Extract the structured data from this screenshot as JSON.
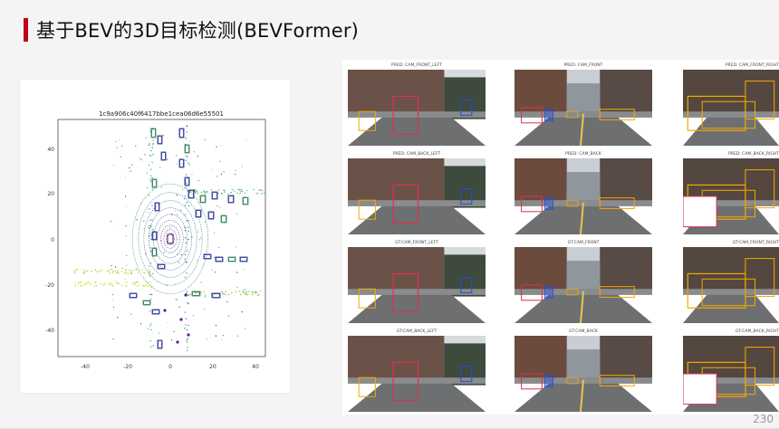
{
  "slide": {
    "title": "基于BEV的3D目标检测(BEVFormer)",
    "page_number": "230",
    "accent_color": "#c0001a"
  },
  "bev_plot": {
    "title": "1c9a906c40f6417bbe1cea06d6e55501",
    "x_ticks": [
      "-40",
      "-20",
      "0",
      "20",
      "40"
    ],
    "y_ticks": [
      "40",
      "20",
      "0",
      "-20",
      "-40"
    ]
  },
  "cameras": [
    {
      "label": "PRED: CAM_FRONT_LEFT"
    },
    {
      "label": "PRED: CAM_FRONT"
    },
    {
      "label": "PRED: CAM_FRONT_RIGHT"
    },
    {
      "label": "PRED: CAM_BACK_LEFT"
    },
    {
      "label": "PRED: CAM_BACK"
    },
    {
      "label": "PRED: CAM_BACK_RIGHT"
    },
    {
      "label": "GT:CAM_FRONT_LEFT"
    },
    {
      "label": "GT:CAM_FRONT"
    },
    {
      "label": "GT:CAM_FRONT_RIGHT"
    },
    {
      "label": "GT:CAM_BACK_LEFT"
    },
    {
      "label": "GT:CAM_BACK"
    },
    {
      "label": "GT:CAM_BACK_RIGHT"
    }
  ]
}
